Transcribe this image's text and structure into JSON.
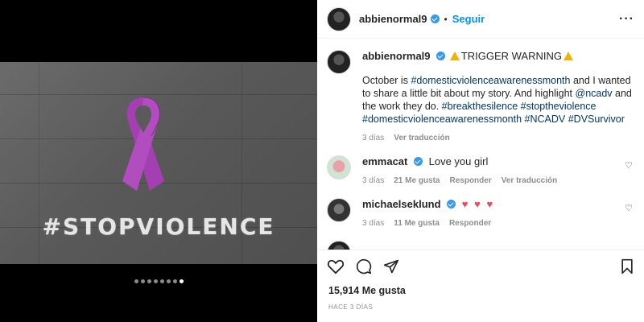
{
  "post": {
    "username": "abbienormal9",
    "follow_label": "Seguir",
    "more_icon": "more-options-icon"
  },
  "media": {
    "overlay_text": "#STOPVIOLENCE",
    "ribbon_color": "#a43fb2",
    "carousel": {
      "count": 8,
      "active_index": 7
    }
  },
  "caption": {
    "username": "abbienormal9",
    "title": "TRIGGER WARNING",
    "text_parts": [
      {
        "t": "October is ",
        "link": false
      },
      {
        "t": "#domesticviolenceawarenessmonth",
        "link": true
      },
      {
        "t": " and I wanted to share a little bit about my story. And highlight ",
        "link": false
      },
      {
        "t": "@ncadv",
        "link": true
      },
      {
        "t": " and the work they do. ",
        "link": false
      },
      {
        "t": "#breakthesilence",
        "link": true
      },
      {
        "t": " ",
        "link": false
      },
      {
        "t": "#stoptheviolence",
        "link": true
      },
      {
        "t": " ",
        "link": false
      },
      {
        "t": "#domesticviolenceawarenessmonth",
        "link": true
      },
      {
        "t": " ",
        "link": false
      },
      {
        "t": "#NCADV",
        "link": true
      },
      {
        "t": " ",
        "link": false
      },
      {
        "t": "#DVSurvivor",
        "link": true
      }
    ],
    "time": "3 días",
    "translate": "Ver traducción"
  },
  "comments": [
    {
      "username": "emmacat",
      "text": "Love you girl",
      "time": "3 días",
      "likes": "21 Me gusta",
      "reply": "Responder",
      "translate": "Ver traducción"
    },
    {
      "username": "michaelseklund",
      "text": "♥ ♥ ♥",
      "time": "3 días",
      "likes": "11 Me gusta",
      "reply": "Responder",
      "translate": ""
    }
  ],
  "footer": {
    "likes": "15,914 Me gusta",
    "ago": "HACE 3 DÍAS"
  },
  "colors": {
    "accent": "#0095f6",
    "verified": "#3897f0",
    "link": "#00376b",
    "muted": "#8e8e8e"
  }
}
